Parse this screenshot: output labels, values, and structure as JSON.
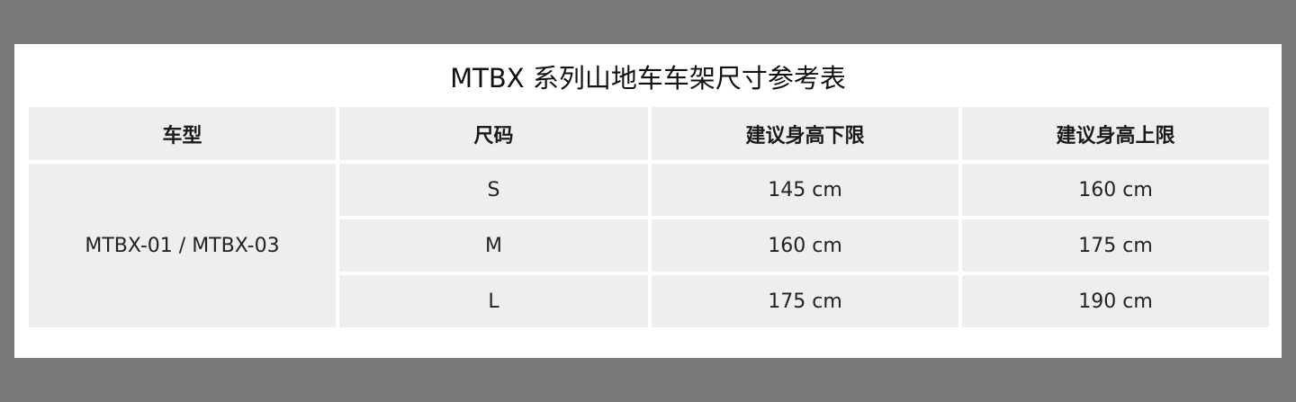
{
  "title": "MTBX 系列山地车车架尺寸参考表",
  "table": {
    "headers": [
      "车型",
      "尺码",
      "建议身高下限",
      "建议身高上限"
    ],
    "model": "MTBX-01 / MTBX-03",
    "rows": [
      {
        "size": "S",
        "min": "145 cm",
        "max": "160 cm"
      },
      {
        "size": "M",
        "min": "160 cm",
        "max": "175 cm"
      },
      {
        "size": "L",
        "min": "175 cm",
        "max": "190 cm"
      }
    ]
  },
  "colors": {
    "backdrop": "#7a7a7a",
    "card": "#ffffff",
    "cell": "#eeeeee",
    "text": "#1a1a1a"
  }
}
